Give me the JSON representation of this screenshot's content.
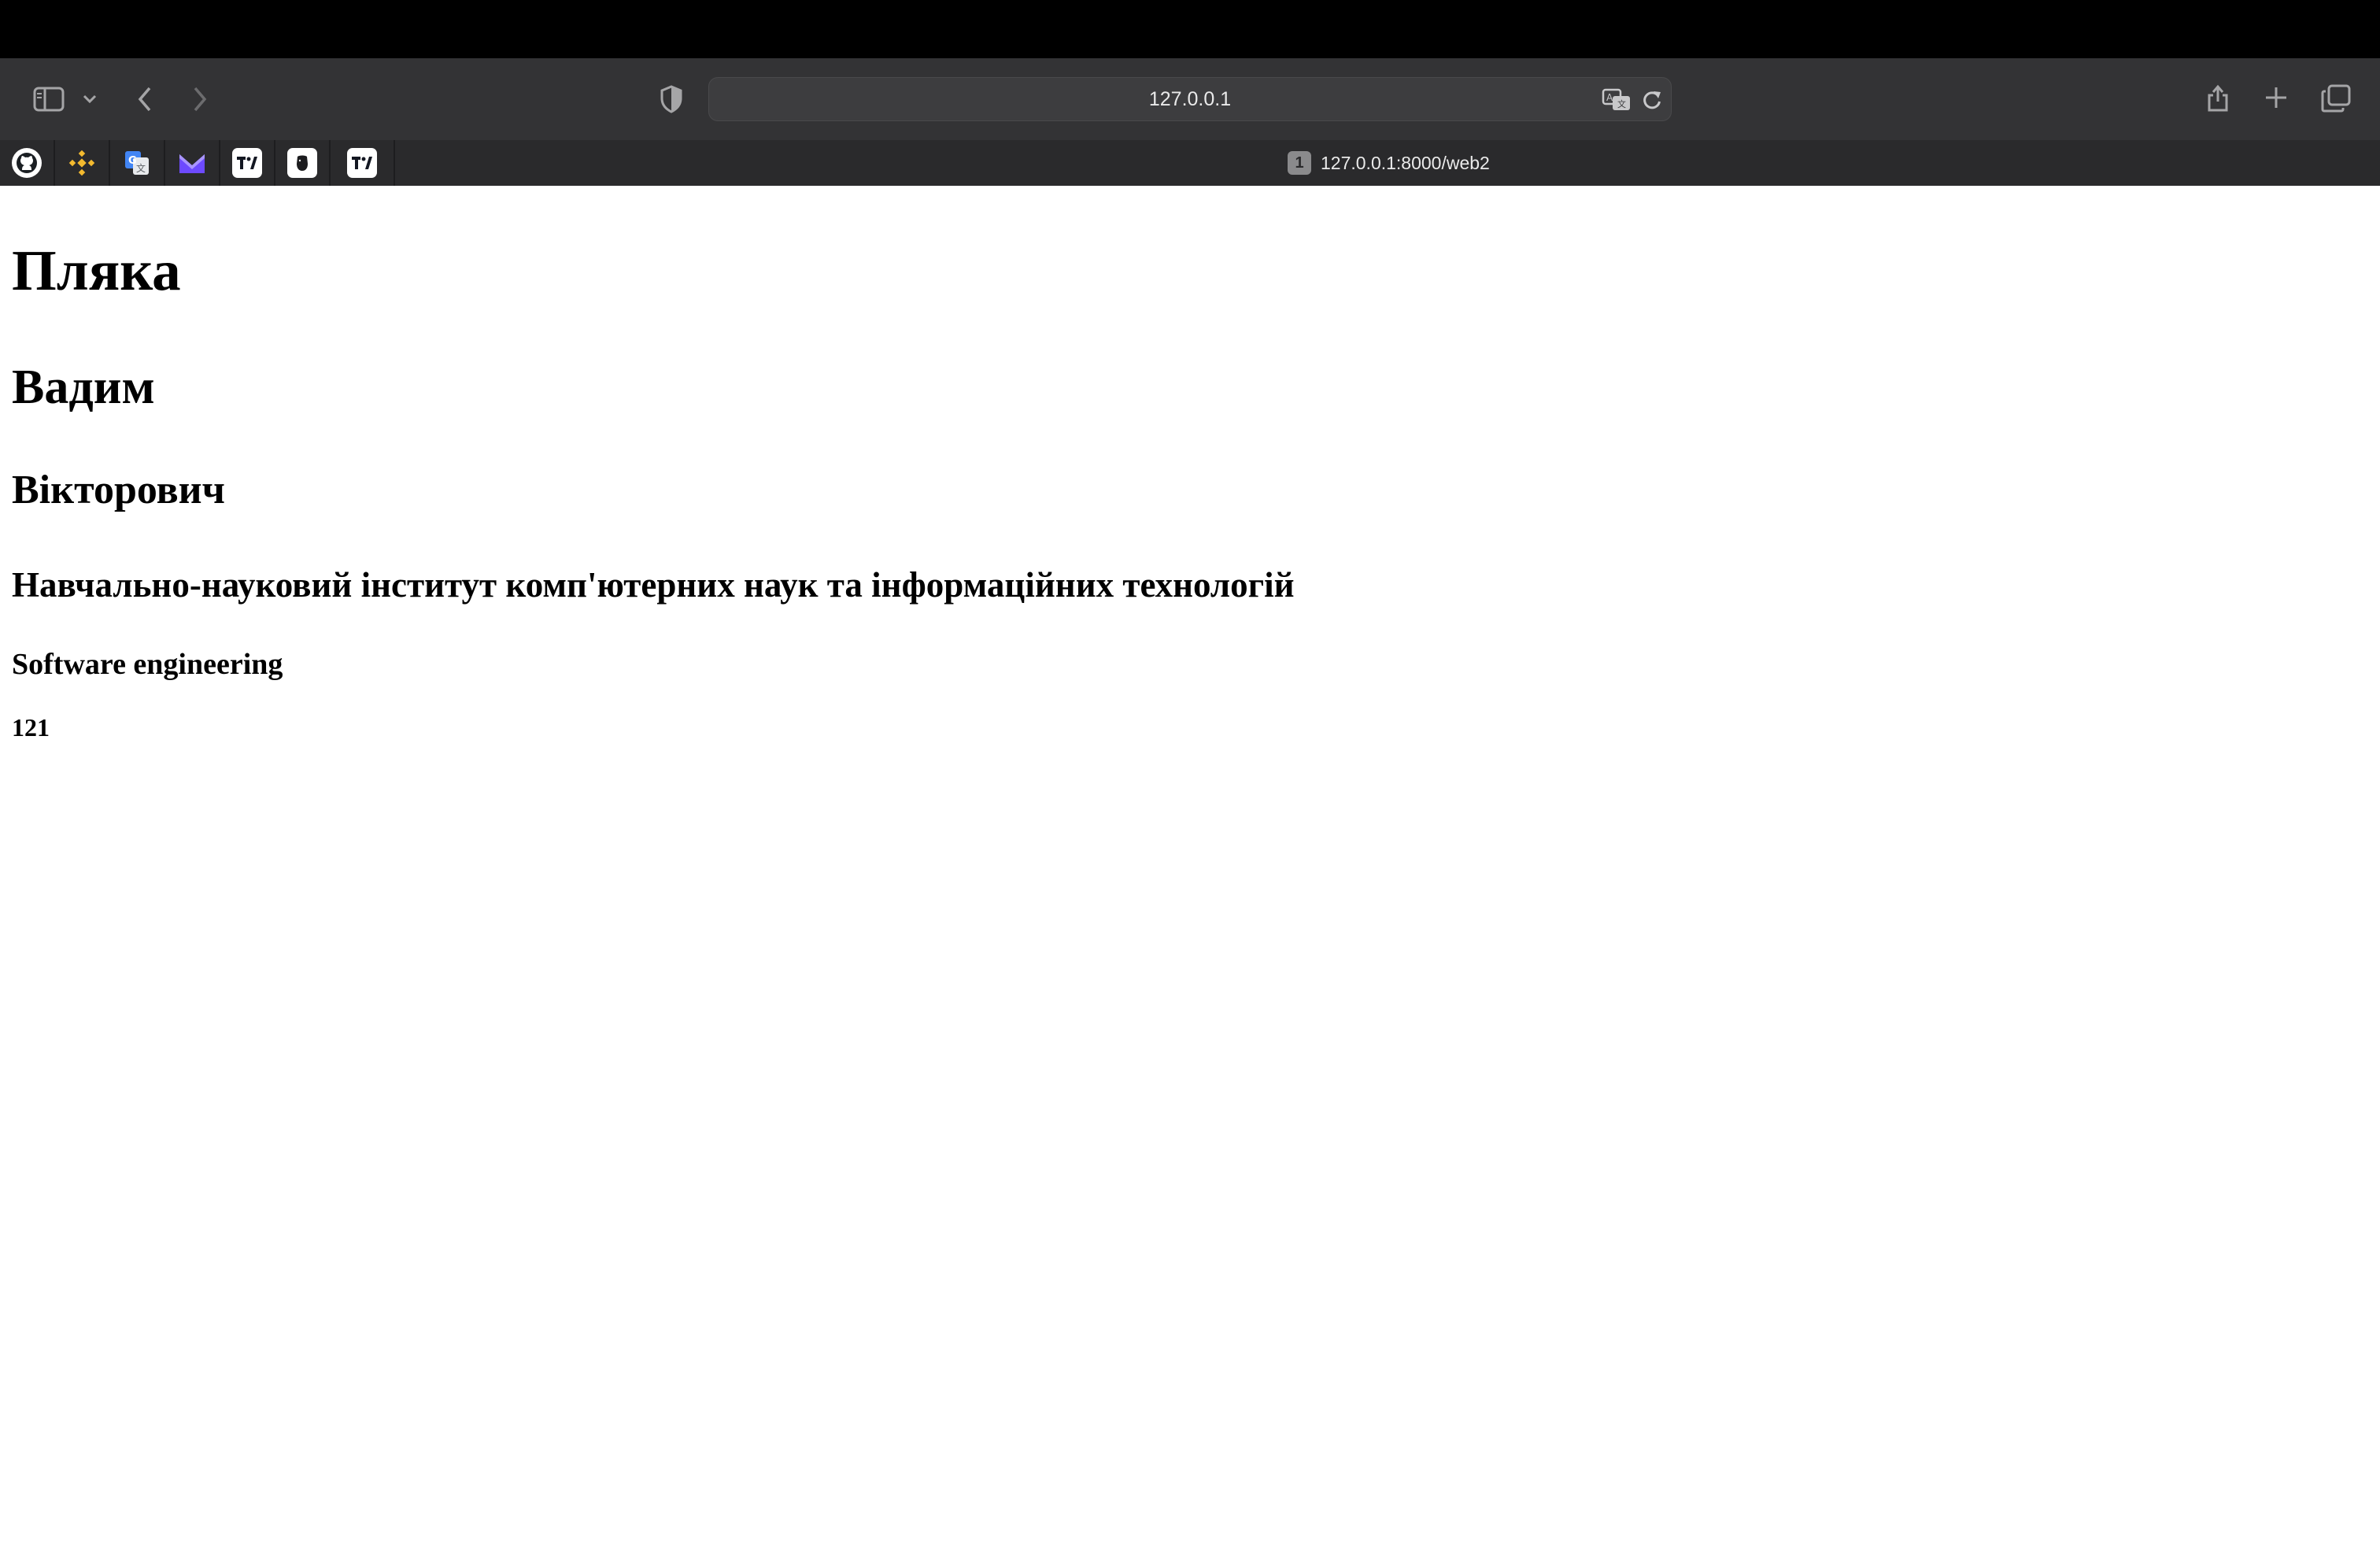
{
  "browser": {
    "address": "127.0.0.1",
    "tab": {
      "number": "1",
      "title": "127.0.0.1:8000/web2"
    },
    "toolbar_icons": [
      "sidebar-icon",
      "chevron-down-icon",
      "back-icon",
      "forward-icon",
      "shield-icon",
      "translate-icon",
      "reload-icon",
      "share-icon",
      "plus-icon",
      "tabs-overview-icon"
    ],
    "favorites": [
      {
        "name": "github-icon",
        "color": "#ffffff"
      },
      {
        "name": "binance-icon",
        "color": "#f3ba2f"
      },
      {
        "name": "google-translate-icon",
        "color": "#4285f4"
      },
      {
        "name": "proton-mail-icon",
        "color": "#8b6cf0"
      },
      {
        "name": "tradingview-icon",
        "color": "#ffffff"
      },
      {
        "name": "bear-icon",
        "color": "#ffffff"
      },
      {
        "name": "tradingview-icon",
        "color": "#ffffff"
      }
    ]
  },
  "page": {
    "h1": "Пляка",
    "h2": "Вадим",
    "h3": "Вікторович",
    "h4": "Навчально-науковий інститут комп'ютерних наук та інформаційних технологій",
    "h5": "Software engineering",
    "h6": "121"
  }
}
